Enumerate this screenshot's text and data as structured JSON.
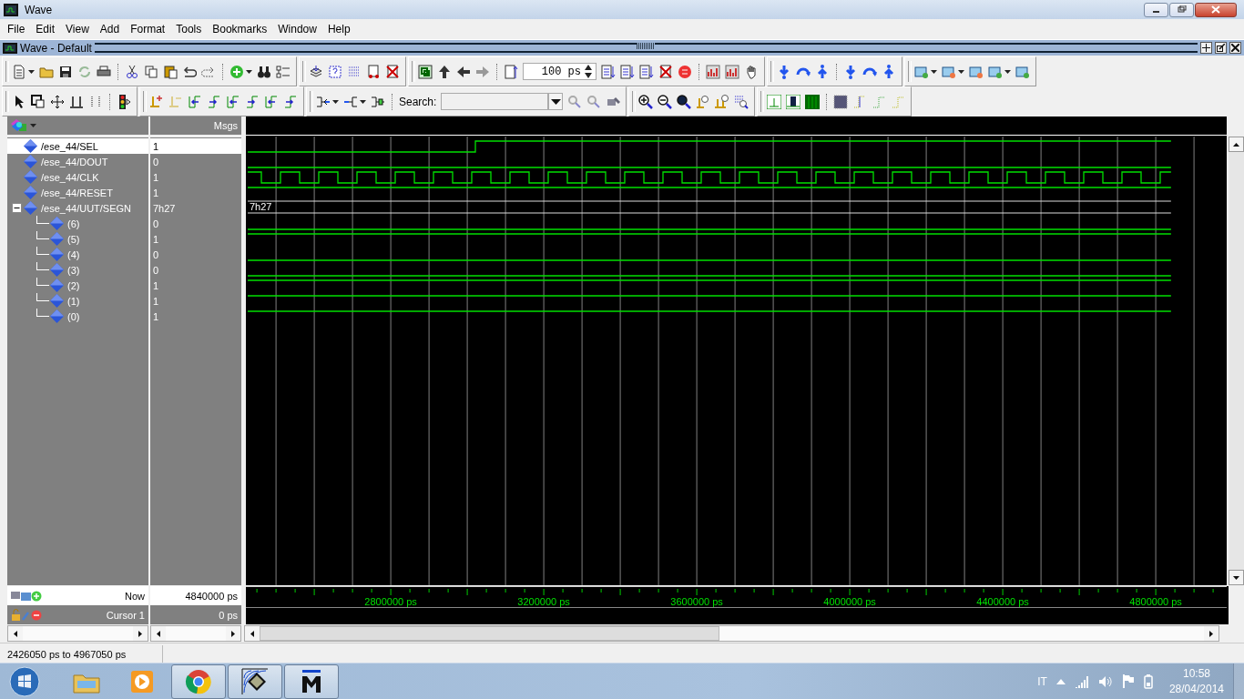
{
  "window": {
    "title": "Wave"
  },
  "menu": [
    "File",
    "Edit",
    "View",
    "Add",
    "Format",
    "Tools",
    "Bookmarks",
    "Window",
    "Help"
  ],
  "subwindow": {
    "title": "Wave - Default"
  },
  "toolbar": {
    "zoom_value": "100 ps",
    "search_label": "Search:"
  },
  "wave": {
    "header": "Msgs",
    "signals": [
      {
        "name": "/ese_44/SEL",
        "value": "1",
        "kind": "step",
        "high": true,
        "selected": true
      },
      {
        "name": "/ese_44/DOUT",
        "value": "0",
        "kind": "bit",
        "high": false,
        "selected": false
      },
      {
        "name": "/ese_44/CLK",
        "value": "1",
        "kind": "clock",
        "high": true,
        "selected": false
      },
      {
        "name": "/ese_44/RESET",
        "value": "1",
        "kind": "bit",
        "high": true,
        "selected": false
      },
      {
        "name": "/ese_44/UUT/SEGN",
        "value": "7h27",
        "kind": "bus",
        "bus_label": "7h27",
        "selected": false,
        "expanded": true,
        "children": [
          {
            "name": "(6)",
            "value": "0",
            "kind": "bit",
            "high": false,
            "selected": false
          },
          {
            "name": "(5)",
            "value": "1",
            "kind": "bit",
            "high": true,
            "selected": false
          },
          {
            "name": "(4)",
            "value": "0",
            "kind": "bit",
            "high": false,
            "selected": false
          },
          {
            "name": "(3)",
            "value": "0",
            "kind": "bit",
            "high": false,
            "selected": false
          },
          {
            "name": "(2)",
            "value": "1",
            "kind": "bit",
            "high": true,
            "selected": false
          },
          {
            "name": "(1)",
            "value": "1",
            "kind": "bit",
            "high": true,
            "selected": false
          },
          {
            "name": "(0)",
            "value": "1",
            "kind": "bit",
            "high": true,
            "selected": false
          }
        ]
      }
    ]
  },
  "cursors": [
    {
      "label": "Now",
      "time": "4840000 ps",
      "kind": "now"
    },
    {
      "label": "Cursor 1",
      "time": "0 ps",
      "kind": "cursor"
    }
  ],
  "ruler": [
    "2800000 ps",
    "3200000 ps",
    "3600000 ps",
    "4000000 ps",
    "4400000 ps",
    "4800000 ps"
  ],
  "status_bar": {
    "range": "2426050 ps to 4967050 ps"
  },
  "taskbar": {
    "language": "IT",
    "time": "10:58",
    "date": "28/04/2014"
  }
}
